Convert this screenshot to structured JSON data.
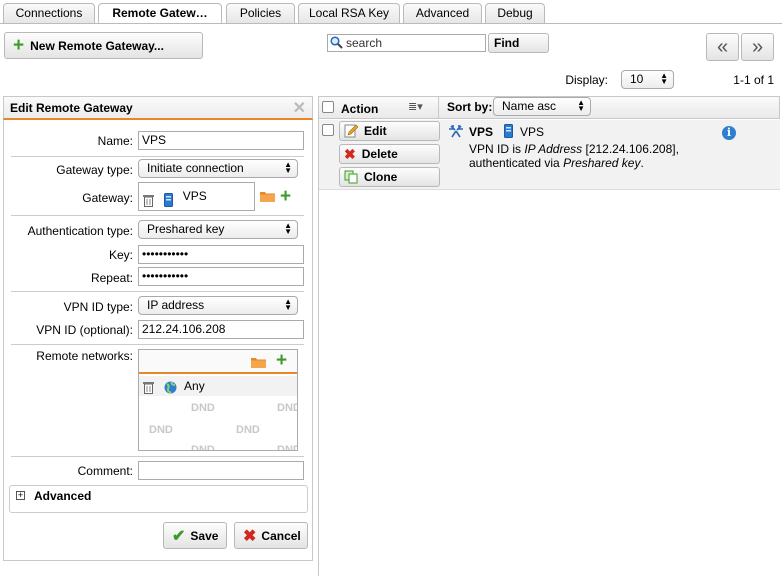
{
  "tabs": [
    {
      "label": "Connections"
    },
    {
      "label": "Remote Gatew…"
    },
    {
      "label": "Policies"
    },
    {
      "label": "Local RSA Key"
    },
    {
      "label": "Advanced"
    },
    {
      "label": "Debug"
    }
  ],
  "toolbar": {
    "new_gateway_label": "New Remote Gateway...",
    "search_placeholder": "search",
    "find_label": "Find",
    "display_label": "Display:",
    "display_value": "10",
    "range_text": "1-1 of 1",
    "prev_label": "«",
    "next_label": "»"
  },
  "form": {
    "title": "Edit Remote Gateway",
    "name_label": "Name:",
    "name_value": "VPS",
    "gateway_type_label": "Gateway type:",
    "gateway_type_value": "Initiate connection",
    "gateway_label": "Gateway:",
    "gateway_value": "VPS",
    "auth_type_label": "Authentication type:",
    "auth_type_value": "Preshared key",
    "key_label": "Key:",
    "key_value": "•••••••••••",
    "repeat_label": "Repeat:",
    "repeat_value": "•••••••••••",
    "vpn_id_type_label": "VPN ID type:",
    "vpn_id_type_value": "IP address",
    "vpn_id_label": "VPN ID (optional):",
    "vpn_id_value": "212.24.106.208",
    "remote_networks_label": "Remote networks:",
    "remote_network_item": "Any",
    "dnd_text": "DND",
    "comment_label": "Comment:",
    "comment_value": "",
    "advanced_label": "Advanced",
    "save_label": "Save",
    "cancel_label": "Cancel"
  },
  "list": {
    "action_header": "Action",
    "sort_label": "Sort by:",
    "sort_value": "Name asc",
    "edit_label": "Edit",
    "delete_label": "Delete",
    "clone_label": "Clone",
    "entry": {
      "name": "VPS",
      "gateway": "VPS",
      "desc_prefix": "VPN ID is ",
      "desc_id_type": "IP Address",
      "desc_id_value": " [212.24.106.208],",
      "desc_auth_prefix": "authenticated via ",
      "desc_auth_type": "Preshared key",
      "desc_suffix": "."
    }
  },
  "colors": {
    "accent_orange": "#e8862a",
    "add_green": "#3c9a2a",
    "delete_red": "#d0281f",
    "info_blue": "#2f7fd0",
    "host_blue": "#2a7bd0",
    "panel_border": "#c8c8c8"
  }
}
